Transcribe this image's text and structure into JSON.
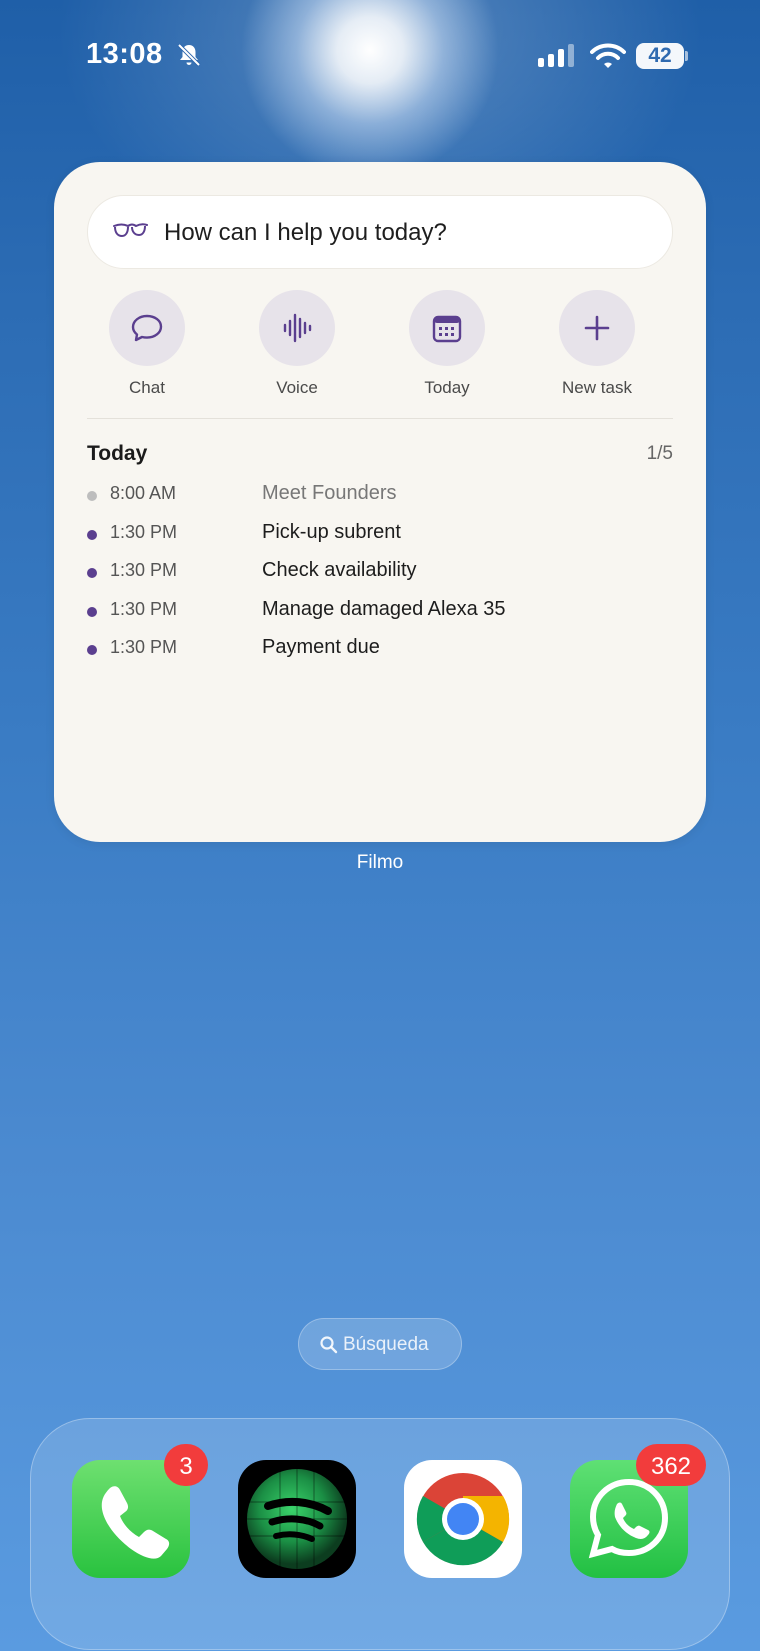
{
  "status_bar": {
    "time": "13:08",
    "battery": "42",
    "icons": [
      "bell-slash-icon",
      "signal-icon",
      "wifi-icon",
      "battery-icon"
    ]
  },
  "widget": {
    "prompt": {
      "text": "How can I help you today?",
      "icon": "glasses-icon"
    },
    "actions": [
      {
        "label": "Chat",
        "icon": "chat-bubble-icon"
      },
      {
        "label": "Voice",
        "icon": "waveform-icon"
      },
      {
        "label": "Today",
        "icon": "calendar-icon"
      },
      {
        "label": "New task",
        "icon": "plus-icon"
      }
    ],
    "today": {
      "heading": "Today",
      "count": "1/5",
      "events": [
        {
          "time": "8:00 AM",
          "title": "Meet Founders",
          "state": "past"
        },
        {
          "time": "1:30 PM",
          "title": "Pick-up subrent",
          "state": "upcoming"
        },
        {
          "time": "1:30 PM",
          "title": "Check availability",
          "state": "upcoming"
        },
        {
          "time": "1:30 PM",
          "title": "Manage damaged Alexa 35",
          "state": "upcoming"
        },
        {
          "time": "1:30 PM",
          "title": "Payment due",
          "state": "upcoming"
        }
      ]
    },
    "app_name": "Filmo"
  },
  "search": {
    "label": "Búsqueda",
    "icon": "search-icon"
  },
  "dock": {
    "apps": [
      {
        "name": "Phone",
        "icon": "phone-icon",
        "badge": "3"
      },
      {
        "name": "Spotify",
        "icon": "spotify-icon",
        "badge": ""
      },
      {
        "name": "Chrome",
        "icon": "chrome-icon",
        "badge": ""
      },
      {
        "name": "WhatsApp",
        "icon": "whatsapp-icon",
        "badge": "362"
      }
    ]
  },
  "colors": {
    "accent": "#5b3f8f",
    "widget_bg": "#f8f6f1",
    "badge": "#f23c3c"
  }
}
